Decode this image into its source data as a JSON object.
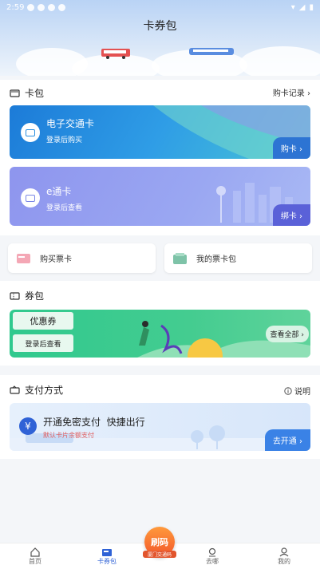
{
  "status_bar": {
    "time": "2:59"
  },
  "header": {
    "title": "卡券包"
  },
  "card_wallet": {
    "title": "卡包",
    "purchase_record": "购卡记录",
    "electronic_card": {
      "name": "电子交通卡",
      "subtitle": "登录后购买",
      "button": "购卡"
    },
    "e_card": {
      "name": "e通卡",
      "subtitle": "登录后查看",
      "button": "绑卡"
    },
    "buy_ticket_card": "购买票卡",
    "my_ticket_wallet": "我的票卡包"
  },
  "coupon_wallet": {
    "title": "券包",
    "coupon_label": "优惠券",
    "login_to_view": "登录后查看",
    "view_all": "查看全部"
  },
  "payment": {
    "title": "支付方式",
    "help": "说明",
    "headline": "开通免密支付  快捷出行",
    "subtitle": "默认卡片余额支付",
    "button": "去开通"
  },
  "tabbar": {
    "home": "首页",
    "wallet": "卡券包",
    "scan_code": "刷码",
    "scan_sub": "厦门交通码",
    "nearby": "去哪",
    "mine": "我的"
  },
  "colors": {
    "accent": "#2f62d6",
    "card1": "#2a8fe0",
    "card2": "#8a96f0",
    "coupon": "#2ec28a"
  }
}
